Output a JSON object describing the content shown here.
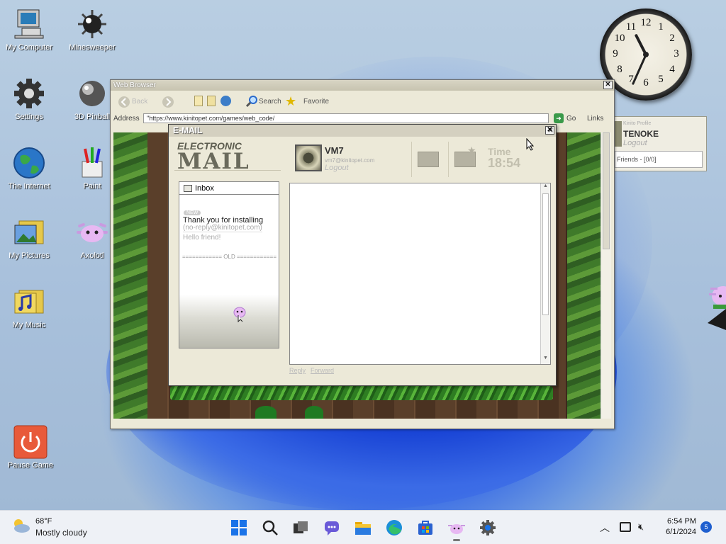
{
  "desktop": {
    "icons": [
      {
        "label": "My Computer"
      },
      {
        "label": "Minesweeper"
      },
      {
        "label": "Settings"
      },
      {
        "label": "3D Pinball"
      },
      {
        "label": "The Internet"
      },
      {
        "label": "Paint"
      },
      {
        "label": "My Pictures"
      },
      {
        "label": "Axolotl"
      },
      {
        "label": "My Music"
      },
      {
        "label": "Pause Game"
      }
    ]
  },
  "clock": {
    "numbers": [
      "12",
      "1",
      "2",
      "3",
      "4",
      "5",
      "6",
      "7",
      "8",
      "9",
      "10",
      "11"
    ]
  },
  "browser": {
    "title": "Web Browser",
    "toolbar": {
      "back": "Back",
      "search": "Search",
      "favorite": "Favorite"
    },
    "address_label": "Address",
    "address": "\"https://www.kinitopet.com/games/web_code/",
    "go": "Go",
    "links": "Links"
  },
  "login_panel": {
    "small": "Kinito Profile",
    "name": "TENOKE",
    "logout": "Logout",
    "friends": "Friends - [0/0]"
  },
  "email": {
    "title": "E-MAIL",
    "logo_top": "ELECTRONIC",
    "logo_bottom": "MAIL",
    "user": {
      "name": "VM7",
      "sub": "vm7@kinitopet.com",
      "logout": "Logout"
    },
    "time_label": "Time",
    "time_value": "18:54",
    "inbox": {
      "label": "Inbox",
      "new_tag": "NEW",
      "subject": "Thank you for installing",
      "from": "(no-reply@kinitopet.com)",
      "preview": "Hello friend!",
      "old_separator": "============ OLD ============"
    },
    "reply": "Reply",
    "forward": "Forward"
  },
  "taskbar": {
    "weather_temp": "68°F",
    "weather_desc": "Mostly cloudy",
    "time": "6:54 PM",
    "date": "6/1/2024",
    "notifications": "5"
  },
  "colors": {
    "accent": "#1f5fcf",
    "window_bg": "#ece9d8"
  }
}
